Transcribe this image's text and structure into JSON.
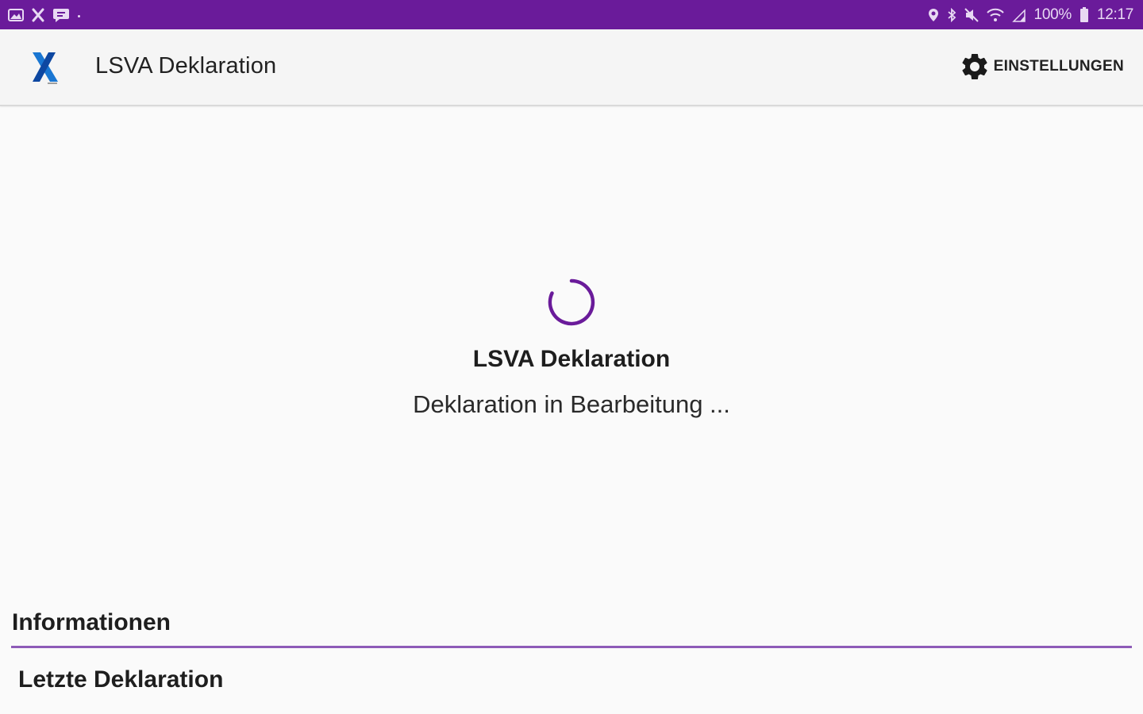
{
  "statusbar": {
    "battery": "100%",
    "time": "12:17",
    "left_icons": [
      "image-icon",
      "x-app-icon",
      "chat-icon"
    ],
    "right_icons": [
      "location-icon",
      "bluetooth-icon",
      "mute-icon",
      "wifi-icon",
      "signal-icon",
      "battery-icon"
    ]
  },
  "appbar": {
    "title": "LSVA Deklaration",
    "settings_label": "EINSTELLUNGEN"
  },
  "loader": {
    "title": "LSVA Deklaration",
    "message": "Deklaration in Bearbeitung ..."
  },
  "info": {
    "heading": "Informationen",
    "last_declaration": "Letzte Deklaration"
  },
  "colors": {
    "statusbar": "#6a1b9a",
    "accent": "#6a1b9a",
    "divider": "#8e5bb8",
    "logo_blue": "#1976d2"
  }
}
